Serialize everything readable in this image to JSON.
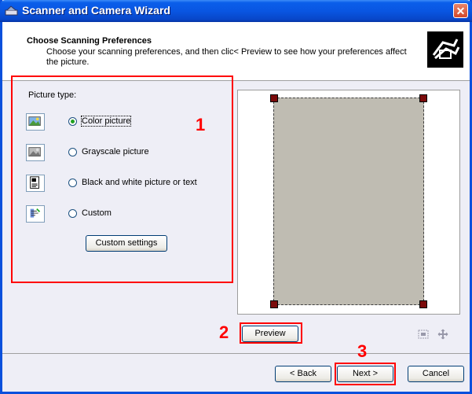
{
  "window": {
    "title": "Scanner and Camera Wizard",
    "close_label": "✕"
  },
  "header": {
    "title": "Choose Scanning Preferences",
    "subtitle": "Choose your scanning preferences, and then clic< Preview to see how your preferences affect the picture."
  },
  "picture_type": {
    "label": "Picture type:",
    "options": [
      {
        "label": "Color picture",
        "selected": true,
        "icon": "color-photo-icon"
      },
      {
        "label": "Grayscale picture",
        "selected": false,
        "icon": "grayscale-photo-icon"
      },
      {
        "label": "Black and white picture or text",
        "selected": false,
        "icon": "bw-text-icon"
      },
      {
        "label": "Custom",
        "selected": false,
        "icon": "custom-settings-icon"
      }
    ],
    "custom_settings_label": "Custom settings"
  },
  "preview": {
    "button_label": "Preview",
    "tools": [
      "zoom-icon",
      "pan-icon"
    ]
  },
  "nav": {
    "back_label": "< Back",
    "next_label": "Next >",
    "cancel_label": "Cancel"
  },
  "annotations": {
    "marker1": "1",
    "marker2": "2",
    "marker3": "3",
    "color": "#FF0000"
  },
  "colors": {
    "titlebar": "#0A5EEA",
    "radio_selected": "#21A121",
    "annotation": "#FF0000"
  }
}
